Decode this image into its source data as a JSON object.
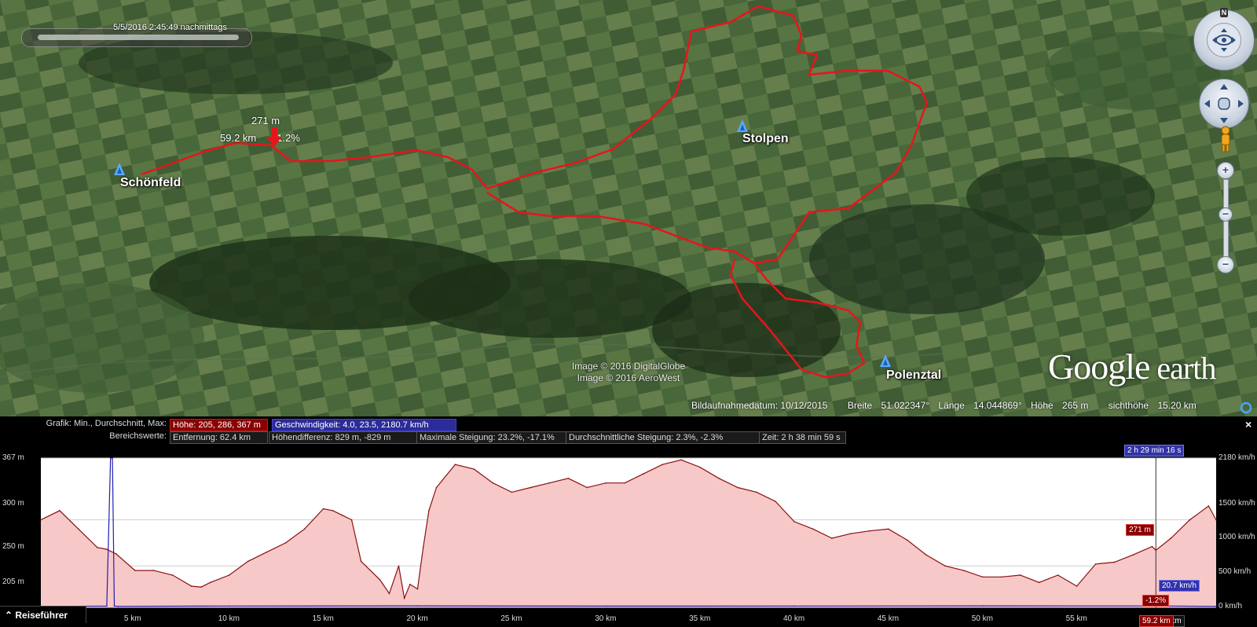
{
  "map": {
    "timeslider_date": "5/5/2016   2:45:49 nachmittags",
    "places": [
      {
        "name": "Schönfeld"
      },
      {
        "name": "Stolpen"
      },
      {
        "name": "Polenztal"
      }
    ],
    "cursor": {
      "elevation": "271 m",
      "distance": "59.2 km",
      "grade": "-1.2%"
    },
    "attribution": [
      "Image © 2016 DigitalGlobe",
      "Image © 2016 AeroWest"
    ],
    "status": {
      "capture_date_label": "Bildaufnahmedatum: 10/12/2015",
      "lat_label": "Breite",
      "lat_value": "51.022347°",
      "lon_label": "Länge",
      "lon_value": "14.044869°",
      "elev_label": "Höhe",
      "elev_value": "265 m",
      "eye_label": "sichthöhe",
      "eye_value": "15.20 km"
    },
    "compass_north": "N",
    "zoom_plus": "+",
    "zoom_minus": "−",
    "logo_google": "Google",
    "logo_earth": " earth",
    "route_color": "#e8141c"
  },
  "profile": {
    "graph_label": "Grafik: Min., Durchschnitt, Max:",
    "range_label": "Bereichswerte:",
    "height_stat": "Höhe: 205, 286, 367 m",
    "speed_stat": "Geschwindigkeit: 4.0, 23.5, 2180.7 km/h",
    "distance_stat": "Entfernung: 62.4 km",
    "height_diff_stat": "Höhendifferenz: 829 m, -829 m",
    "max_slope_stat": "Maximale Steigung: 23.2%, -17.1%",
    "avg_slope_stat": "Durchschnittliche Steigung: 2.3%, -2.3%",
    "time_stat": "Zeit: 2 h 38 min 59 s",
    "close": "×",
    "left_axis": [
      "367 m",
      "300 m",
      "250 m",
      "205 m"
    ],
    "right_axis": [
      "2180 km/h",
      "1500 km/h",
      "1000 km/h",
      "500 km/h",
      "0 km/h"
    ],
    "x_ticks": [
      "5 km",
      "10 km",
      "15 km",
      "20 km",
      "25 km",
      "30 km",
      "35 km",
      "40 km",
      "45 km",
      "50 km",
      "55 km"
    ],
    "x_end": "62.4 km",
    "marker_time": "2 h 29 min 16 s",
    "marker_elev": "271 m",
    "marker_speed": "20.7 km/h",
    "marker_grade": "-1.2%",
    "marker_dist": "59.2 km",
    "travel_guide": "Reiseführer",
    "colors": {
      "elevation_line": "#8b1010",
      "elevation_fill": "#f7c8c8",
      "speed_line": "#2020b0",
      "grid": "#cfcfcf"
    }
  },
  "chart_data": {
    "type": "area",
    "xlabel": "",
    "ylabel": "",
    "xlim": [
      0,
      62.4
    ],
    "ylim": [
      205,
      367
    ],
    "series": [
      {
        "name": "Höhe",
        "x": [
          0,
          1,
          2,
          3,
          3.5,
          4,
          5,
          6,
          7,
          8,
          8.5,
          9,
          10,
          11,
          12,
          13,
          14,
          15,
          15.5,
          16,
          16.5,
          17,
          18,
          18.5,
          19,
          19.3,
          19.6,
          20,
          20.3,
          20.6,
          21,
          22,
          23,
          24,
          25,
          26,
          27,
          28,
          29,
          30,
          31,
          32,
          33,
          34,
          35,
          36,
          37,
          38,
          39,
          40,
          41,
          42,
          43,
          44,
          45,
          46,
          47,
          48,
          49,
          50,
          51,
          52,
          53,
          54,
          55,
          56,
          57,
          58,
          59,
          59.2,
          60,
          61,
          62,
          62.4
        ],
        "y": [
          300,
          310,
          290,
          270,
          268,
          263,
          245,
          245,
          240,
          228,
          227,
          232,
          240,
          255,
          265,
          275,
          290,
          312,
          310,
          305,
          300,
          255,
          235,
          220,
          250,
          215,
          230,
          225,
          270,
          310,
          335,
          360,
          355,
          340,
          330,
          335,
          340,
          345,
          335,
          340,
          340,
          350,
          360,
          365,
          357,
          345,
          335,
          330,
          320,
          298,
          290,
          280,
          285,
          288,
          290,
          278,
          262,
          250,
          245,
          238,
          238,
          240,
          232,
          240,
          228,
          252,
          254,
          262,
          271,
          267,
          280,
          300,
          315,
          300
        ]
      },
      {
        "name": "Geschwindigkeit",
        "x": [
          0,
          3.5,
          3.7,
          3.8,
          3.9,
          4.1,
          10,
          20,
          30,
          40,
          50,
          59.2,
          62.4
        ],
        "y": [
          15,
          18,
          2180,
          2180,
          20,
          15,
          20,
          22,
          18,
          20,
          22,
          20.7,
          15
        ]
      }
    ]
  }
}
